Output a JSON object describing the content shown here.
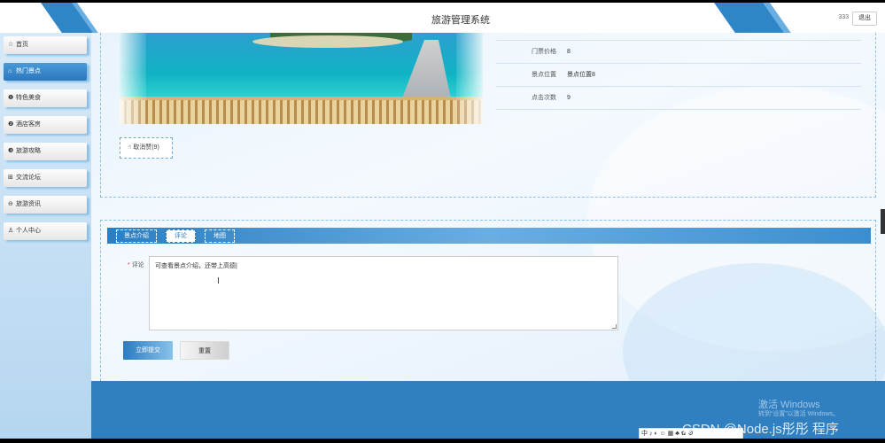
{
  "header": {
    "title": "旅游管理系统",
    "user": "333",
    "logout_label": "退出"
  },
  "sidebar": {
    "items": [
      {
        "label": "首页",
        "icon": "star-icon",
        "glyph": "☆"
      },
      {
        "label": "热门景点",
        "icon": "home-icon",
        "glyph": "⌂"
      },
      {
        "label": "特色美食",
        "icon": "info-icon",
        "glyph": "❶"
      },
      {
        "label": "酒店客房",
        "icon": "info-icon",
        "glyph": "❷"
      },
      {
        "label": "旅游攻略",
        "icon": "info-icon",
        "glyph": "❸"
      },
      {
        "label": "交流论坛",
        "icon": "grid-icon",
        "glyph": "⊞"
      },
      {
        "label": "旅游资讯",
        "icon": "minus-circle-icon",
        "glyph": "⊖"
      },
      {
        "label": "个人中心",
        "icon": "user-icon",
        "glyph": "♙"
      }
    ],
    "active_index": 1
  },
  "detail": {
    "rows": [
      {
        "key": "门票价格",
        "value": "8"
      },
      {
        "key": "景点位置",
        "value": "景点位置8"
      },
      {
        "key": "点击次数",
        "value": "9"
      }
    ],
    "cancel_like_label": "取消赞(9)"
  },
  "tabs": [
    {
      "label": "景点介绍"
    },
    {
      "label": "评论"
    },
    {
      "label": "地图"
    }
  ],
  "active_tab": 1,
  "comment": {
    "label": "评论",
    "required_mark": "*",
    "value": "可查看景点介绍，还带上高德|"
  },
  "buttons": {
    "submit_label": "立即提交",
    "reset_label": "重置"
  },
  "overlay": {
    "activation_title": "激活 Windows",
    "activation_sub": "转到“设置”以激活 Windows。",
    "csdn": "CSDN @Node.js彤彤  程序",
    "tray_text": "中 ♪ ◐ ☺ ▦ ♣ ✿ ⚙"
  },
  "colors": {
    "accent": "#2f7fc1",
    "active_nav": "#2b78bd",
    "panel_border": "#8cc0e8"
  }
}
